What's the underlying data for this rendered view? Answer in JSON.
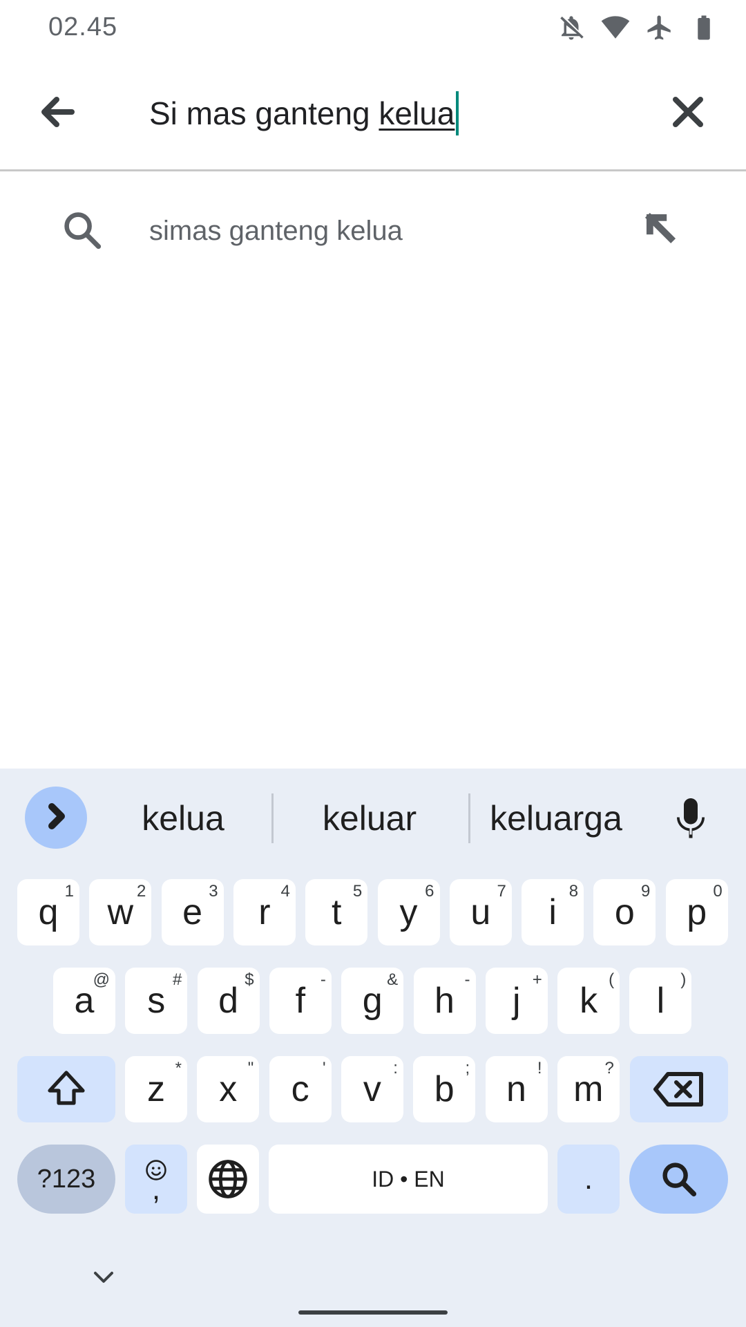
{
  "status_bar": {
    "time": "02.45",
    "icons": [
      "notifications-off-icon",
      "wifi-icon",
      "airplane-mode-icon",
      "battery-icon"
    ]
  },
  "search": {
    "query_prefix": "Si mas ganteng ",
    "query_composing": "kelua",
    "back_icon": "arrow-back-icon",
    "clear_icon": "close-icon"
  },
  "suggestions": [
    {
      "text": "simas ganteng kelua",
      "icon": "search-icon",
      "action_icon": "arrow-up-left-icon"
    }
  ],
  "keyboard": {
    "word_suggestions": [
      "kelua",
      "keluar",
      "keluarga"
    ],
    "row1": [
      {
        "key": "q",
        "hint": "1"
      },
      {
        "key": "w",
        "hint": "2"
      },
      {
        "key": "e",
        "hint": "3"
      },
      {
        "key": "r",
        "hint": "4"
      },
      {
        "key": "t",
        "hint": "5"
      },
      {
        "key": "y",
        "hint": "6"
      },
      {
        "key": "u",
        "hint": "7"
      },
      {
        "key": "i",
        "hint": "8"
      },
      {
        "key": "o",
        "hint": "9"
      },
      {
        "key": "p",
        "hint": "0"
      }
    ],
    "row2": [
      {
        "key": "a",
        "hint": "@"
      },
      {
        "key": "s",
        "hint": "#"
      },
      {
        "key": "d",
        "hint": "$"
      },
      {
        "key": "f",
        "hint": "-"
      },
      {
        "key": "g",
        "hint": "&"
      },
      {
        "key": "h",
        "hint": "-"
      },
      {
        "key": "j",
        "hint": "+"
      },
      {
        "key": "k",
        "hint": "("
      },
      {
        "key": "l",
        "hint": ")"
      }
    ],
    "row3": [
      {
        "key": "z",
        "hint": "*"
      },
      {
        "key": "x",
        "hint": "\""
      },
      {
        "key": "c",
        "hint": "'"
      },
      {
        "key": "v",
        "hint": ":"
      },
      {
        "key": "b",
        "hint": ";"
      },
      {
        "key": "n",
        "hint": "!"
      },
      {
        "key": "m",
        "hint": "?"
      }
    ],
    "symbols_label": "?123",
    "comma_label": ",",
    "space_label": "ID • EN",
    "period_label": ".",
    "colors": {
      "background": "#e9eef6",
      "key": "#ffffff",
      "function_key": "#d3e3fd",
      "action_key": "#a8c7fa",
      "cursor": "#00897b"
    }
  }
}
